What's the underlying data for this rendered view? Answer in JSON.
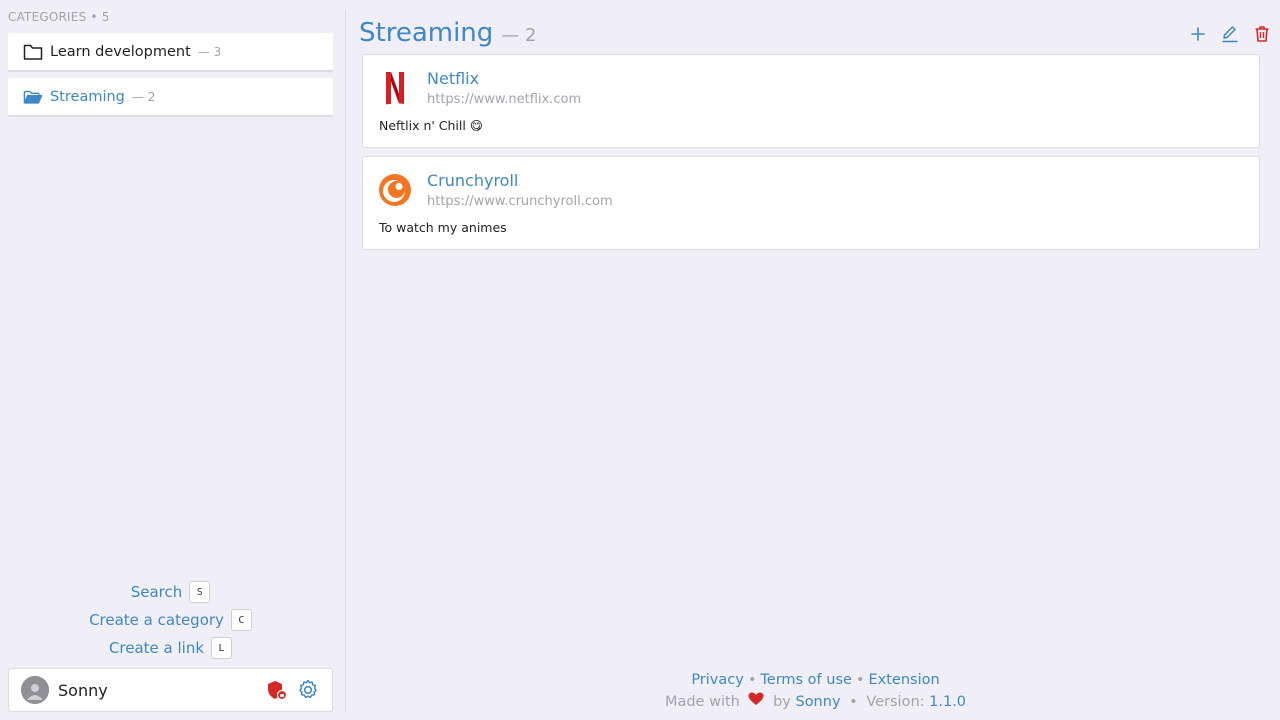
{
  "sidebar": {
    "header_label": "CATEGORIES",
    "header_count": "5",
    "categories": [
      {
        "label": "Learn development",
        "count": "3",
        "active": false
      },
      {
        "label": "Streaming",
        "count": "2",
        "active": true
      }
    ],
    "shortcuts": [
      {
        "label": "Search",
        "key": "S"
      },
      {
        "label": "Create a category",
        "key": "C"
      },
      {
        "label": "Create a link",
        "key": "L"
      }
    ],
    "user": {
      "name": "Sonny"
    }
  },
  "main": {
    "title": "Streaming",
    "count": "2",
    "links": [
      {
        "name": "Netflix",
        "url": "https://www.netflix.com",
        "description": "Neftlix n' Chill 😋",
        "icon": "netflix-logo"
      },
      {
        "name": "Crunchyroll",
        "url": "https://www.crunchyroll.com",
        "description": "To watch my animes",
        "icon": "crunchyroll-logo"
      }
    ]
  },
  "footer": {
    "privacy": "Privacy",
    "terms": "Terms of use",
    "extension": "Extension",
    "made_with": "Made with",
    "by": "by",
    "author": "Sonny",
    "version_label": "Version:",
    "version": "1.1.0"
  },
  "colors": {
    "accent": "#3f88c5",
    "muted": "#a3a3ad",
    "danger": "#d62828",
    "background": "#f0eef6",
    "netflix": "#d81f26",
    "crunchyroll": "#f47521"
  }
}
